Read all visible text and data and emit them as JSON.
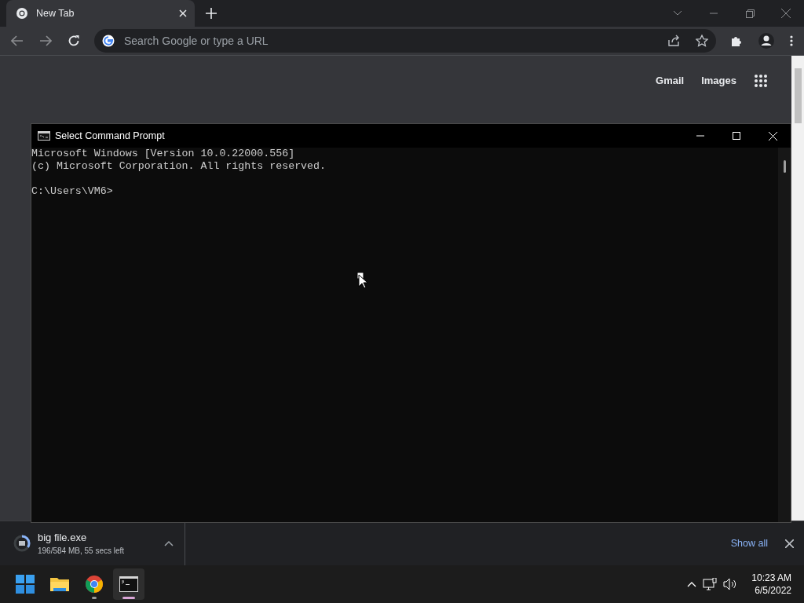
{
  "browser": {
    "tabs": [
      {
        "title": "New Tab",
        "selected": true
      }
    ],
    "address_bar": {
      "placeholder": "Search Google or type a URL"
    },
    "page_links": [
      "Gmail",
      "Images"
    ],
    "download": {
      "file_name": "big file.exe",
      "status": "196/584 MB, 55 secs left",
      "level": 0.34,
      "show_all": "Show all"
    }
  },
  "console_window": {
    "title": "Select Command Prompt",
    "output": [
      "Microsoft Windows [Version 10.0.22000.556]",
      "(c) Microsoft Corporation. All rights reserved."
    ],
    "prompt": "C:\\Users\\VM6>"
  },
  "taskbar": {
    "apps": [
      {
        "kind": "start",
        "running": false,
        "selected": false
      },
      {
        "kind": "explorer",
        "running": false,
        "selected": false
      },
      {
        "kind": "chrome",
        "running": true,
        "selected": false
      },
      {
        "kind": "terminal",
        "running": true,
        "selected": true
      }
    ],
    "time": "10:23 AM",
    "date": "6/5/2022"
  }
}
